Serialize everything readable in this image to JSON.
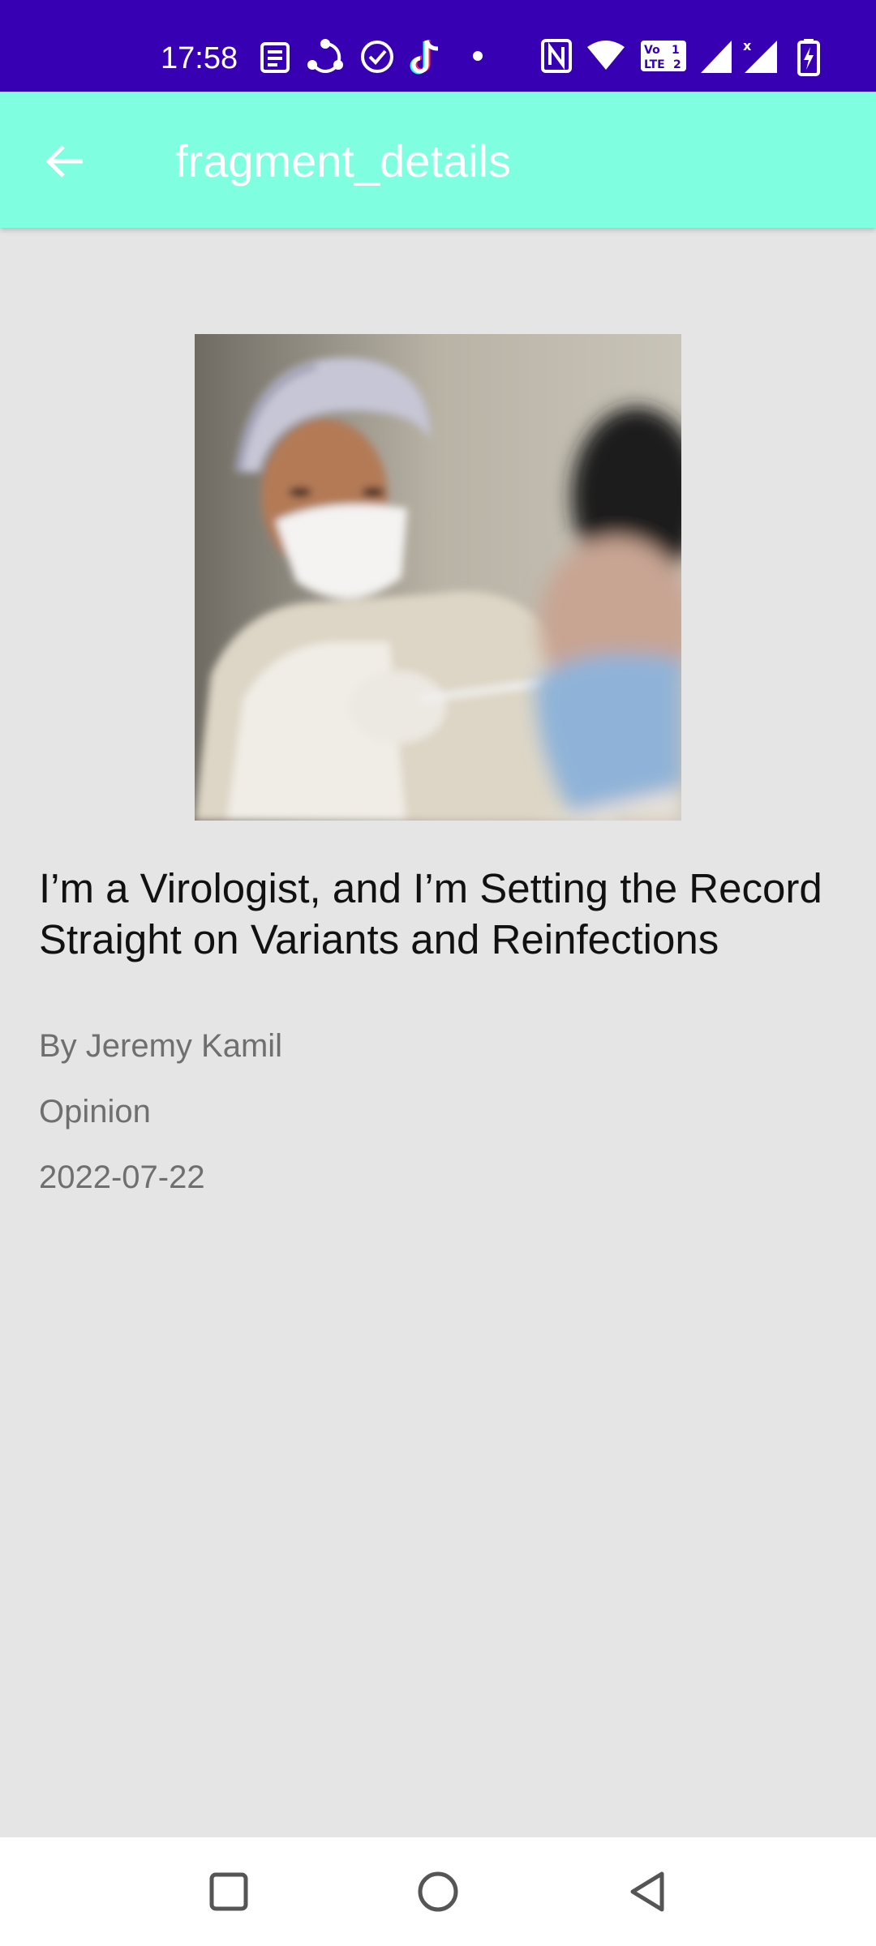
{
  "status_bar": {
    "time": "17:58",
    "background": "#3700b3",
    "icons": [
      "news-icon",
      "share-icon",
      "check-circle-icon",
      "tiktok-icon",
      "dot-icon",
      "nfc-icon",
      "wifi-icon",
      "volte-icon",
      "signal-icon",
      "signal-x-icon",
      "battery-charging-icon"
    ]
  },
  "app_bar": {
    "title": "fragment_details",
    "background": "#7fffdf",
    "back_icon": "arrow-back-icon"
  },
  "article": {
    "title": "I’m a Virologist, and I’m Setting the Record Straight on Variants and Reinfections",
    "author": "By Jeremy Kamil",
    "section": "Opinion",
    "date": "2022-07-22"
  },
  "nav_bar": {
    "icons": [
      "recents-square-icon",
      "home-circle-icon",
      "back-triangle-icon"
    ]
  }
}
